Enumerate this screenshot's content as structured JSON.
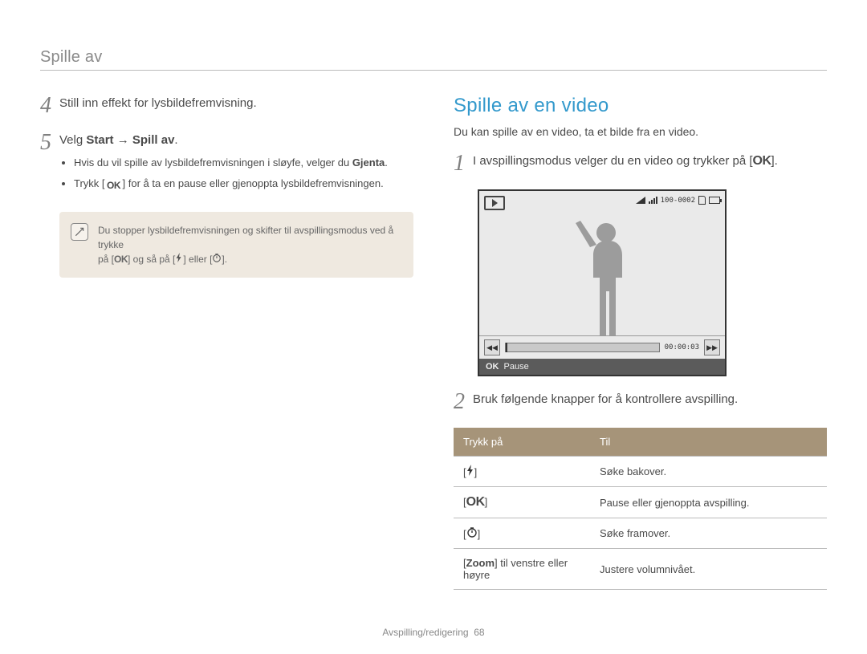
{
  "header": {
    "breadcrumb": "Spille av"
  },
  "left": {
    "step4": {
      "num": "4",
      "text": "Still inn effekt for lysbildefremvisning."
    },
    "step5": {
      "num": "5",
      "prefix": "Velg ",
      "emph": "Start → Spill av",
      "suffix": ".",
      "bullet1_prefix": "Hvis du vil spille av lysbildefremvisningen i sløyfe, velger du ",
      "bullet1_emph": "Gjenta",
      "bullet1_suffix": ".",
      "bullet2_prefix": "Trykk [",
      "bullet2_icon": "OK",
      "bullet2_suffix": "] for å ta en pause eller gjenoppta lysbildefremvisningen."
    },
    "note": {
      "line1": "Du stopper lysbildefremvisningen og skifter til avspillingsmodus ved å trykke",
      "line2_a": "på [",
      "line2_ok": "OK",
      "line2_b": "] og så på [",
      "line2_c": "] eller [",
      "line2_d": "]."
    }
  },
  "right": {
    "title": "Spille av en video",
    "desc": "Du kan spille av en video, ta et bilde fra en video.",
    "step1": {
      "num": "1",
      "prefix": "I avspillingsmodus velger du en video og trykker på [",
      "ok": "OK",
      "suffix": "]."
    },
    "screen": {
      "counter": "100-0002",
      "time": "00:00:03",
      "footer_ok": "OK",
      "footer_label": "Pause"
    },
    "step2": {
      "num": "2",
      "text": "Bruk følgende knapper for å kontrollere avspilling."
    },
    "table": {
      "head": {
        "c1": "Trykk på",
        "c2": "Til"
      },
      "row1": {
        "c2": "Søke bakover."
      },
      "row2": {
        "c1": "OK",
        "c2": "Pause eller gjenoppta avspilling."
      },
      "row3": {
        "c2": "Søke framover."
      },
      "row4": {
        "c1_a": "[",
        "c1_b": "Zoom",
        "c1_c": "] til venstre eller høyre",
        "c2": "Justere volumnivået."
      }
    }
  },
  "footer": {
    "section": "Avspilling/redigering",
    "page": "68"
  }
}
